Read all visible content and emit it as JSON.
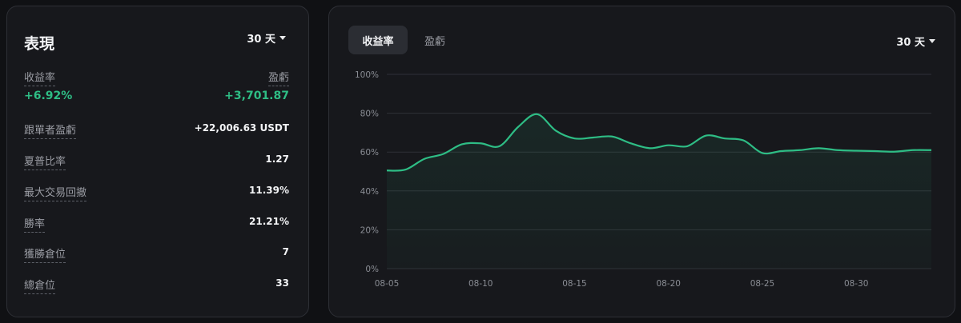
{
  "performance": {
    "title": "表現",
    "range_label": "30 天",
    "yield": {
      "label": "收益率",
      "value": "+6.92%"
    },
    "pnl": {
      "label": "盈虧",
      "value": "+3,701.87"
    },
    "stats": [
      {
        "label": "跟單者盈虧",
        "value": "+22,006.63 USDT",
        "accent": true
      },
      {
        "label": "夏普比率",
        "value": "1.27"
      },
      {
        "label": "最大交易回撤",
        "value": "11.39%"
      },
      {
        "label": "勝率",
        "value": "21.21%"
      },
      {
        "label": "獲勝倉位",
        "value": "7"
      },
      {
        "label": "總倉位",
        "value": "33"
      }
    ]
  },
  "chart_panel": {
    "tabs": [
      {
        "label": "收益率",
        "active": true
      },
      {
        "label": "盈虧",
        "active": false
      }
    ],
    "range_label": "30 天"
  },
  "chart_data": {
    "type": "area",
    "ylim": [
      0,
      100
    ],
    "y_ticks": [
      "100%",
      "80%",
      "60%",
      "40%",
      "20%",
      "0%"
    ],
    "x_ticks": [
      "08-05",
      "08-10",
      "08-15",
      "08-20",
      "08-25",
      "08-30"
    ],
    "x_dates": [
      "08-05",
      "08-06",
      "08-07",
      "08-08",
      "08-09",
      "08-10",
      "08-11",
      "08-12",
      "08-13",
      "08-14",
      "08-15",
      "08-16",
      "08-17",
      "08-18",
      "08-19",
      "08-20",
      "08-21",
      "08-22",
      "08-23",
      "08-24",
      "08-25",
      "08-26",
      "08-27",
      "08-28",
      "08-29",
      "08-30",
      "08-31",
      "09-01",
      "09-02",
      "09-03"
    ],
    "series": [
      {
        "values": [
          50.5,
          51,
          56.5,
          59,
          64,
          64.5,
          63,
          73,
          79.5,
          71,
          67,
          67.5,
          68,
          64.5,
          62,
          63.5,
          63,
          68.5,
          67,
          66,
          59.5,
          60.5,
          61,
          62,
          61,
          60.7,
          60.5,
          60.2,
          61,
          61
        ]
      }
    ],
    "colors": {
      "line": "#2ebd85",
      "grid": "#2f3137"
    }
  }
}
